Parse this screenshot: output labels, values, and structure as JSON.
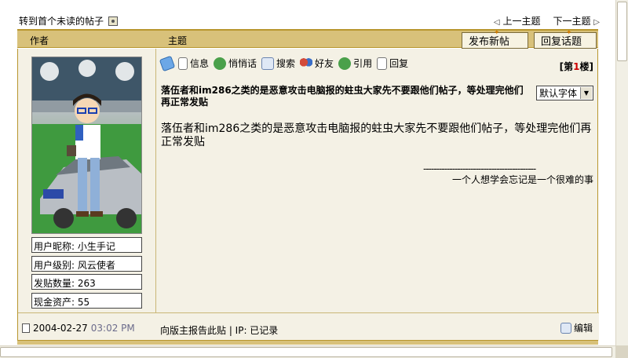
{
  "nav": {
    "first_unread": "转到首个未读的帖子",
    "prev_topic": "上一主题",
    "next_topic": "下一主题"
  },
  "header": {
    "author": "作者",
    "topic": "主题",
    "post_button": "发布新帖",
    "reply_button": "回复话题"
  },
  "author": {
    "nickname": "用户昵称: 小生手记",
    "level": "用户级别: 风云使者",
    "posts": "发贴数量: 263",
    "cash": "现金资产: 55"
  },
  "toolbar": {
    "info": "信息",
    "whisper": "悄悄话",
    "search": "搜索",
    "friend": "好友",
    "quote": "引用",
    "reply": "回复"
  },
  "floor": {
    "prefix": "[第",
    "num": "1",
    "suffix": "楼]"
  },
  "post": {
    "title": "落伍者和im286之类的是恶意攻击电脑报的蛀虫大家先不要跟他们帖子，等处理完他们再正常发贴",
    "font_select": "默认字体",
    "body": "落伍者和im286之类的是恶意攻击电脑报的蛀虫大家先不要跟他们帖子，等处理完他们再正常发贴",
    "sig_line": "-------------------------------------------",
    "signature": "一个人想学会忘记是一个很难的事"
  },
  "footer": {
    "date": "2004-02-27",
    "time": "03:02 PM",
    "report": "向版主报告此贴 | IP: 已记录",
    "edit": "编辑"
  },
  "colors": {
    "header_bg": "#d8c17a",
    "border": "#b8962e",
    "panel_bg": "#f4f1e5",
    "floor_num": "#cc0000"
  }
}
